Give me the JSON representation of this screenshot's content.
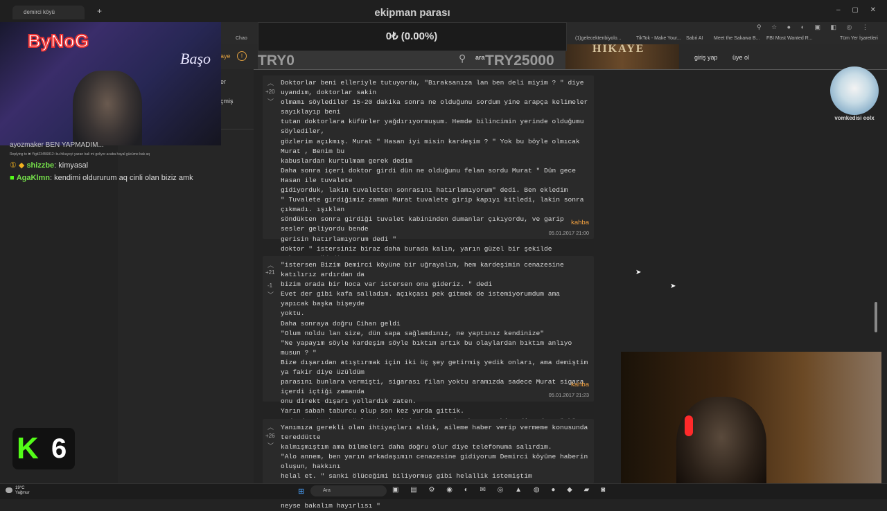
{
  "browser": {
    "tab_title": "demirci köyü",
    "bookmarks": [
      "Chao",
      "(1)gelecektenbiyolo...",
      "TikTok - Make Your...",
      "Sabri AI",
      "Meet the Sakawa B...",
      "FBI Most Wanted R...",
      "Tüm Yer İşaretleri"
    ]
  },
  "overlay": {
    "title": "ekipman parası",
    "donation_value": "0₺ (0.00%)",
    "try_min": "TRY0",
    "try_max": "TRY25000",
    "search_text": "ara"
  },
  "site": {
    "header_fragment": "aye",
    "login": "giriş yap",
    "register": "üye ol",
    "sidebar_item1": "er",
    "sidebar_item2": "çmiş"
  },
  "stream": {
    "logo": "ByNoG",
    "neon": "Başo",
    "chat_fragment": "ayozmaker BEN YAPMADIM...",
    "chat_reply": "Replying to ✖ Yigit23456812: bu hikayeyi yazan bali mi geliyor acaba hayal gücüme bak aq",
    "messages": [
      {
        "user": "shizzbe",
        "text": "kimyasal"
      },
      {
        "user": "AgaKlmn",
        "text": "kendimi oldururum aq cinli olan biziz amk"
      }
    ],
    "kick_count": "6"
  },
  "posts": [
    {
      "votes": "+20",
      "text": "Doktorlar beni elleriyle tutuyordu, \"Bıraksanıza lan ben deli miyim ? \" diye uyandım, doktorlar sakin\nolmamı söylediler 15-20 dakika sonra ne olduğunu sordum yine arapça kelimeler sayıklayıp beni\ntutan doktorlara küfürler yağdırıyormuşum. Hemde bilincimin yerinde olduğumu söylediler,\ngözlerim açıkmış. Murat \" Hasan iyi misin kardeşim ? \" Yok bu böyle olmıcak Murat , Benim bu\nkabuslardan kurtulmam gerek dedim\nDaha sonra içeri doktor girdi dün ne olduğunu felan sordu Murat \" Dün gece Hasan ile tuvalete\ngidiyorduk, lakin tuvaletten sonrasını hatırlamıyorum\" dedi. Ben ekledim\n\" Tuvalete girdiğimiz zaman Murat tuvalete girip kapıyı kitledi, lakin sonra çıkmadı. ışıklan\nsöndükten sonra girdiği tuvalet kabininden dumanlar çıkıyordu, ve garip sesler geliyordu bende\ngerisin hatırlamıyorum dedi \"\ndoktor \" istersiniz biraz daha burada kalın, yarın güzel bir şekilde çıkarsınız\"dedi\nAğlıyordum, pgibolojim bozulmuştu gençliğimin baharında, üniversiteye gidiyordum, yarın öbür\ngün sınavlar başlıyacaktı, ne yapıcaktım o zaman ben ?\nMurat daha sonra :",
      "author": "kahba",
      "date": "05.01.2017 21:00"
    },
    {
      "votes": "+21",
      "votes_down": "-1",
      "text": "\"istersen Bizim Demirci köyüne bir uğrayalım, hem kardeşimin cenazesine katılırız ardırdan da\nbizim orada bir hoca var istersen ona gideriz. \" dedi\nEvet der gibi kafa salladım. açıkçası pek gitmek de istemiyorumdum ama yapıcak başka bişeyde\nyoktu.\nDaha sonraya doğru Cihan geldi\n\"Olum noldu lan size, dün sapa sağlamdınız, ne yaptınız kendinize\"\n\"Ne yapayım söyle kardeşim söyle bıktım artık bu olaylardan bıktım anlıyo musun ? \"\nBize dışarıdan atıştırmak için iki üç şey getirmiş yedik onları, ama demiştim ya fakir diye üzüldüm\nparasını bunlara vermişti, sigarası filan yoktu aramızda sadece Murat sigara içerdi içtiği zamanda\nonu direkt dışarı yollardık zaten.\nYarın sabah taburcu olup son kez yurda gittik.\nArdından korkunç günler benim için başlıyordu. ben onu hissediyordum çünkü.",
      "author": "kahba",
      "date": "05.01.2017 21:23"
    },
    {
      "votes": "+26",
      "text": "Yanımıza gerekli olan ihtiyaçları aldık, aileme haber verip vermeme konusunda tereddütte\nkalmışmıştım ama bilmeleri daha doğru olur diye telefonuma salırdım.\n\"Alo annem, ben yarın arkadaşımın cenazesine gidiyorum Demirci köyüne haberin oluşun, hakkını\nhelal et. \" sanki ölüceğimi biliyormuş gibi helallik istemiştim\n\" Tamam oğlum, başını derde sokma, tez get tez gitde ne bu daha 1 hafta oldu senin orda kalalı,\nneyse bakalım hayırlısı \""
    }
  ],
  "right": {
    "avatar_name": "vomkedisi eolx"
  },
  "taskbar": {
    "temp": "19°C",
    "weather": "Yağmur",
    "search": "Ara"
  }
}
